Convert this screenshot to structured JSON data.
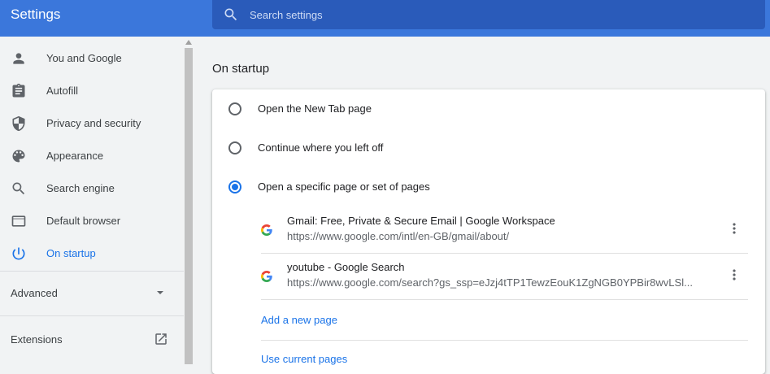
{
  "app": {
    "title": "Settings"
  },
  "search": {
    "placeholder": "Search settings"
  },
  "sidebar": {
    "items": [
      {
        "label": "You and Google",
        "icon": "person-icon"
      },
      {
        "label": "Autofill",
        "icon": "clipboard-icon"
      },
      {
        "label": "Privacy and security",
        "icon": "shield-icon"
      },
      {
        "label": "Appearance",
        "icon": "palette-icon"
      },
      {
        "label": "Search engine",
        "icon": "search-icon"
      },
      {
        "label": "Default browser",
        "icon": "browser-window-icon"
      },
      {
        "label": "On startup",
        "icon": "power-icon",
        "active": true
      }
    ],
    "advanced_label": "Advanced",
    "extensions_label": "Extensions"
  },
  "main": {
    "section_title": "On startup",
    "options": [
      {
        "label": "Open the New Tab page",
        "checked": false
      },
      {
        "label": "Continue where you left off",
        "checked": false
      },
      {
        "label": "Open a specific page or set of pages",
        "checked": true
      }
    ],
    "pages": [
      {
        "title": "Gmail: Free, Private & Secure Email | Google Workspace",
        "url": "https://www.google.com/intl/en-GB/gmail/about/"
      },
      {
        "title": "youtube - Google Search",
        "url": "https://www.google.com/search?gs_ssp=eJzj4tTP1TewzEouK1ZgNGB0YPBir8wvLSl..."
      }
    ],
    "add_page_label": "Add a new page",
    "use_current_label": "Use current pages"
  },
  "colors": {
    "header": "#3b77db",
    "search_bg": "#2a5bba",
    "accent": "#1a73e8",
    "sidebar_bg": "#f1f3f4"
  }
}
